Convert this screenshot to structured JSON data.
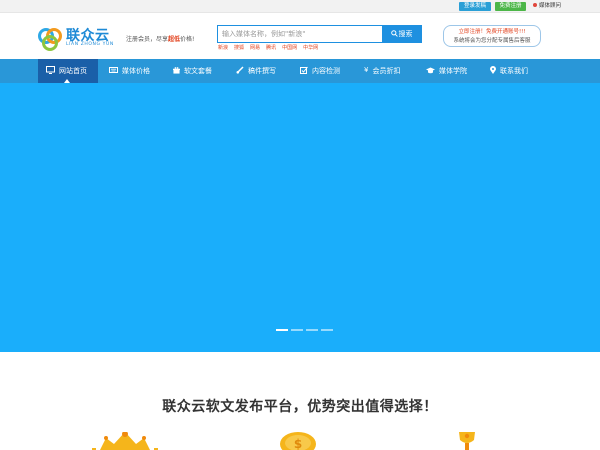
{
  "topbar": {
    "login_label": "登录发稿",
    "register_label": "免费注册",
    "consult_label": "媒体顾问"
  },
  "header": {
    "logo_name": "联众云",
    "logo_sub": "LIAN ZHONG YUN",
    "slogan_prefix": "注册会员，尽享",
    "slogan_highlight": "超低",
    "slogan_suffix": "价格!",
    "search": {
      "placeholder": "输入媒体名称，例如\"新浪\"",
      "value": "",
      "button_label": "搜索"
    },
    "hot_words": [
      "新浪",
      "搜狐",
      "网易",
      "腾讯",
      "中国网",
      "中华网"
    ],
    "promo_line1": "立即注册！免费开通账号!!!",
    "promo_line2": "系统将会为您分配专属售后客服"
  },
  "nav": {
    "items": [
      {
        "label": "网站首页",
        "icon": "monitor-icon"
      },
      {
        "label": "媒体价格",
        "icon": "keyboard-icon"
      },
      {
        "label": "软文套餐",
        "icon": "gift-icon"
      },
      {
        "label": "稿件撰写",
        "icon": "brush-icon"
      },
      {
        "label": "内容检测",
        "icon": "edit-check-icon"
      },
      {
        "label": "会员折扣",
        "icon": "yen-icon"
      },
      {
        "label": "媒体学院",
        "icon": "graduation-cap-icon"
      },
      {
        "label": "联系我们",
        "icon": "map-pin-icon"
      }
    ],
    "active_index": 0
  },
  "banner": {
    "color": "#1aaefb",
    "slide_count": 4,
    "active_slide": 0
  },
  "section": {
    "title": "联众云软文发布平台，优势突出值得选择！"
  },
  "colors": {
    "brand_blue": "#2997d8",
    "nav_active": "#1a5fa8",
    "highlight_red": "#e2401c",
    "register_green": "#4cb648"
  }
}
